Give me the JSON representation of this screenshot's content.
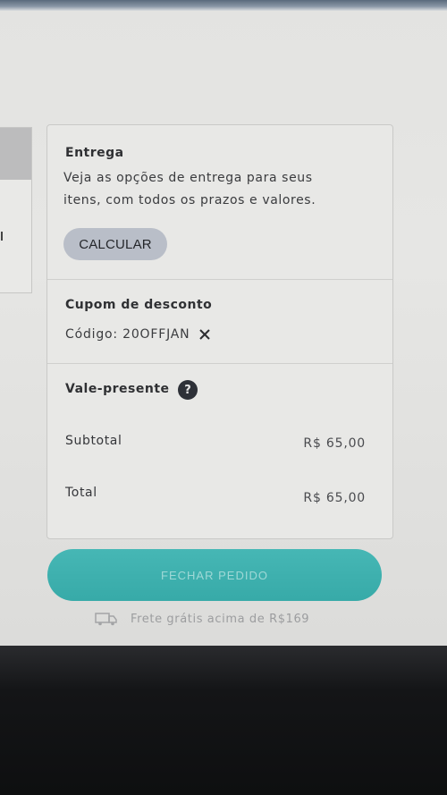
{
  "delivery": {
    "title": "Entrega",
    "description_line1": "Veja as opções de entrega para seus",
    "description_line2": "itens, com todos os prazos e valores.",
    "calculate_label": "CALCULAR"
  },
  "coupon": {
    "title": "Cupom de desconto",
    "code_line": "Código: 20OFFJAN"
  },
  "gift_card": {
    "title": "Vale-presente",
    "help_icon": "question-icon",
    "help_glyph": "?"
  },
  "summary": {
    "subtotal_label": "Subtotal",
    "subtotal_value": "R$ 65,00",
    "total_label": "Total",
    "total_value": "R$ 65,00"
  },
  "checkout": {
    "label": "FECHAR PEDIDO",
    "color": "#3fb1af"
  },
  "shipping_note": {
    "icon": "truck-icon",
    "text": "Frete grátis acima de R$169"
  }
}
